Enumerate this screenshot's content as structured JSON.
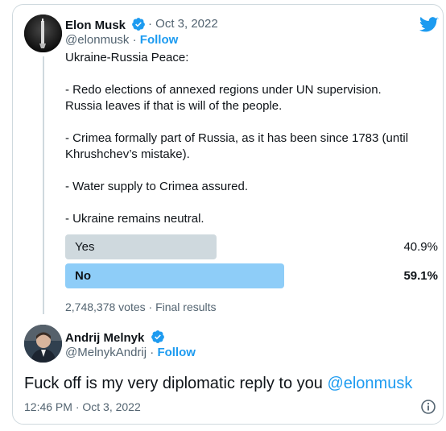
{
  "tweet": {
    "author_name": "Elon Musk",
    "date": "· Oct 3, 2022",
    "handle": "@elonmusk",
    "separator": " · ",
    "follow_label": "Follow",
    "lines": [
      "Ukraine-Russia Peace:",
      "- Redo elections of annexed regions under UN supervision. Russia leaves if that is will of the people.",
      "- Crimea formally part of Russia, as it has been since 1783 (until Khrushchev’s mistake).",
      "- Water supply to Crimea assured.",
      "- Ukraine remains neutral."
    ]
  },
  "poll": {
    "options": [
      {
        "label": "Yes",
        "percent": "40.9%",
        "fraction": 0.409,
        "color": "#cfd9de",
        "winner": false
      },
      {
        "label": "No",
        "percent": "59.1%",
        "fraction": 0.591,
        "color": "#8ecdf8",
        "winner": true
      }
    ],
    "meta": "2,748,378 votes · Final results"
  },
  "reply": {
    "author_name": "Andrij Melnyk",
    "handle": "@MelnykAndrij",
    "separator": " · ",
    "follow_label": "Follow",
    "text_before": "Fuck off is my very diplomatic reply to you ",
    "mention": "@elonmusk",
    "timestamp": "12:46 PM · Oct 3, 2022"
  },
  "colors": {
    "accent": "#1d9bf0",
    "secondary_text": "#536471",
    "border": "#cfd9de"
  },
  "icons": [
    "twitter-bird-icon",
    "verified-badge-icon",
    "info-icon"
  ]
}
